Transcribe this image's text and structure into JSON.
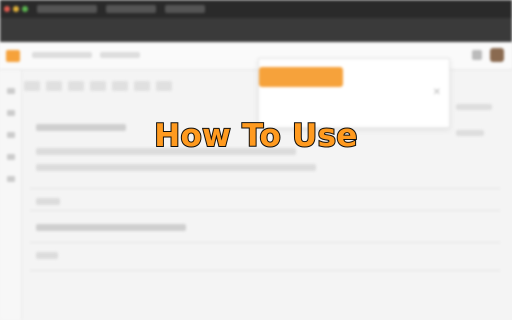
{
  "overlay": {
    "headline": "How To Use"
  },
  "colors": {
    "accent": "#ff9a1f",
    "headline_outline": "#111111",
    "background": "#f4f4f4",
    "dark_bar": "#2a2a2a",
    "panel_button": "#f6a23b"
  },
  "icons": {
    "window_controls": [
      "red-dot-icon",
      "yellow-dot-icon",
      "green-dot-icon"
    ],
    "toolbar": [
      "app-logo-icon",
      "user-avatar-icon",
      "settings-icon"
    ],
    "panel": [
      "close-icon"
    ]
  }
}
